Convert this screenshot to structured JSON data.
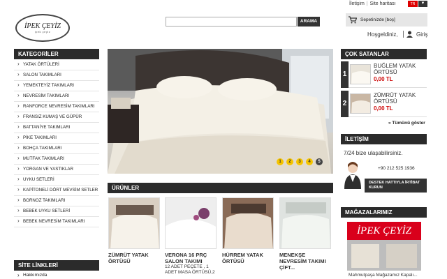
{
  "header": {
    "logo_main": "İPEK ÇEYİZ",
    "logo_sub": "ipek çeyiz",
    "toplinks": [
      "İletişim",
      "Site haritası"
    ],
    "flag_label": "TR",
    "dropdown_glyph": "▼",
    "search": {
      "placeholder": "",
      "value": "",
      "button": "ARAMA"
    },
    "cart_label": "Sepetinizde [boş]",
    "welcome": "Hoşgeldiniz,",
    "login": "Giriş"
  },
  "sidebar": {
    "title": "KATEGORİLER",
    "items": [
      "YATAK ÖRTÜLERİ",
      "SALON TAKIMLARI",
      "YEMEKTEYİZ TAKIMLARI",
      "NEVRESİM TAKIMLARI",
      "RANFORCE NEVRESİM TAKIMLARI",
      "FRANSIZ KUMAŞ VE GÜPÜR",
      "BATTANİYE TAKIMLARI",
      "PİKE TAKIMLARI",
      "BOHÇA TAKIMLARI",
      "MUTFAK TAKIMLARI",
      "YORGAN VE YASTIKLAR",
      "UYKU SETLERİ",
      "KAPİTONELİ DÖRT MEVSİM SETLER",
      "BORNOZ TAKIMLARI",
      "BEBEK UYKU SETLERİ",
      "BEBEK NEVRESİM TAKIMLARI"
    ],
    "links_title": "SİTE LİNKLERİ",
    "links": [
      "Hakkımızda"
    ]
  },
  "slider": {
    "pages": [
      "1",
      "2",
      "3",
      "4",
      "5"
    ],
    "active": "5"
  },
  "products": {
    "title": "ÜRÜNLER",
    "items": [
      {
        "name": "ZÜMRÜT YATAK ÖRTÜSÜ",
        "desc": ""
      },
      {
        "name": "VERONA 16 PRÇ SALON TAKIMI",
        "desc": "12 ADET PEÇETE , 1 ADET MASA ÖRTÜSÜ,2"
      },
      {
        "name": "HÜRREM YATAK ÖRTÜSÜ",
        "desc": ""
      },
      {
        "name": "MENEKŞE NEVRESİM TAKIMI ÇİFT...",
        "desc": ""
      }
    ]
  },
  "bestsellers": {
    "title": "ÇOK SATANLAR",
    "items": [
      {
        "rank": "1",
        "name": "BUĞLEM YATAK ÖRTÜSÜ",
        "price": "0,00 TL"
      },
      {
        "rank": "2",
        "name": "ZÜMRÜT YATAK ÖRTÜSÜ",
        "price": "0,00 TL"
      }
    ],
    "see_all": "» Tümünü göster"
  },
  "contact": {
    "title": "İLETİŞİM",
    "text": "7/24 bize ulaşabilirsiniz.",
    "phone": "+90 212 525 1936",
    "support_button": "DESTEK HATTIYLA İRTİBAT KURUN"
  },
  "stores": {
    "title": "MAĞAZALARIMIZ",
    "sign": "İPEK ÇEYİZ",
    "caption": "Mahmutpaşa Mağazamız Kapalı..."
  },
  "colors": {
    "dark": "#2b2b2b",
    "price": "#cc0000",
    "dot": "#f5c400",
    "sign": "#d9001b"
  }
}
